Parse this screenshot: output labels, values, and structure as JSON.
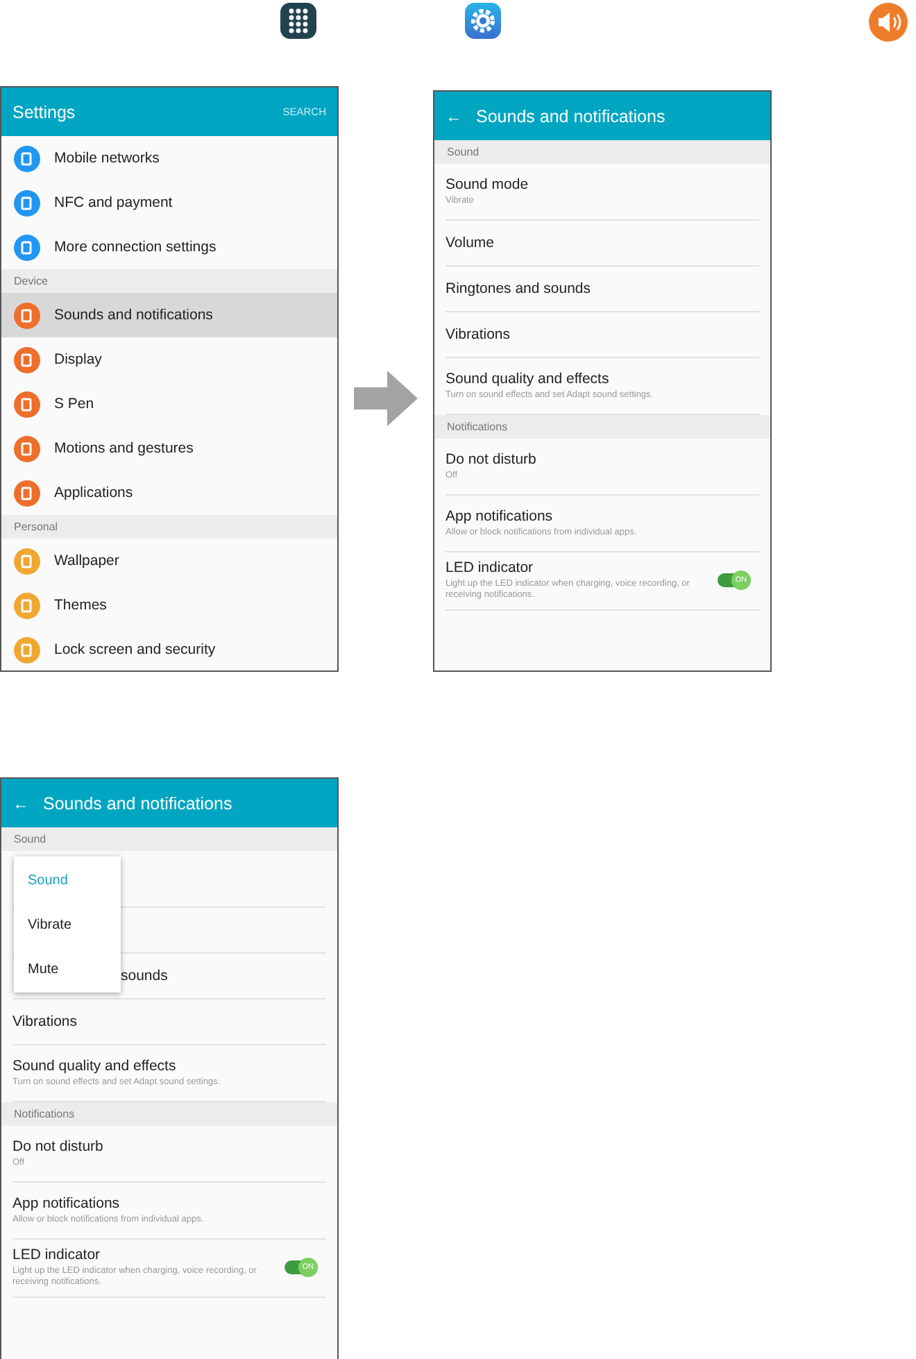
{
  "screens": [
    {
      "kind": "main",
      "title": "Settings",
      "action": "SEARCH",
      "rows": [
        {
          "kind": "item",
          "label": "Mobile networks",
          "color": "#2196f3",
          "selected": false
        },
        {
          "kind": "item",
          "label": "NFC and payment",
          "color": "#2196f3",
          "selected": false
        },
        {
          "kind": "item",
          "label": "More connection settings",
          "color": "#2196f3",
          "selected": false
        },
        {
          "kind": "section",
          "label": "Device"
        },
        {
          "kind": "item",
          "label": "Sounds and notifications",
          "color": "#ee6e2b",
          "selected": true
        },
        {
          "kind": "item",
          "label": "Display",
          "color": "#ee6e2b",
          "selected": false
        },
        {
          "kind": "item",
          "label": "S Pen",
          "color": "#ee6e2b",
          "selected": false
        },
        {
          "kind": "item",
          "label": "Motions and gestures",
          "color": "#ee6e2b",
          "selected": false
        },
        {
          "kind": "item",
          "label": "Applications",
          "color": "#ee6e2b",
          "selected": false
        },
        {
          "kind": "section",
          "label": "Personal"
        },
        {
          "kind": "item",
          "label": "Wallpaper",
          "color": "#f0a732",
          "selected": false
        },
        {
          "kind": "item",
          "label": "Themes",
          "color": "#f0a732",
          "selected": false
        },
        {
          "kind": "item",
          "label": "Lock screen and security",
          "color": "#f0a732",
          "selected": false
        }
      ]
    },
    {
      "kind": "sub",
      "title": "Sounds and notifications",
      "back": "←",
      "rows": [
        {
          "kind": "section",
          "label": "Sound"
        },
        {
          "kind": "item",
          "label": "Sound mode",
          "subtitle": "Vibrate"
        },
        {
          "kind": "item",
          "label": "Volume"
        },
        {
          "kind": "item",
          "label": "Ringtones and sounds"
        },
        {
          "kind": "item",
          "label": "Vibrations"
        },
        {
          "kind": "item",
          "label": "Sound quality and effects",
          "subtitle": "Turn on sound effects and set Adapt sound settings."
        },
        {
          "kind": "section",
          "label": "Notifications"
        },
        {
          "kind": "item",
          "label": "Do not disturb",
          "subtitle": "Off"
        },
        {
          "kind": "item",
          "label": "App notifications",
          "subtitle": "Allow or block notifications from individual apps."
        },
        {
          "kind": "toggle",
          "label": "LED indicator",
          "subtitle": "Light up the LED indicator when charging, voice recording, or receiving notifications.",
          "on": true,
          "toggle_label": "ON"
        }
      ]
    },
    {
      "kind": "sub",
      "title": "Sounds and notifications",
      "back": "←",
      "menu": [
        {
          "label": "Sound",
          "selected": true
        },
        {
          "label": "Vibrate",
          "selected": false
        },
        {
          "label": "Mute",
          "selected": false
        }
      ],
      "rows": [
        {
          "kind": "section",
          "label": "Sound"
        },
        {
          "kind": "blank_tall"
        },
        {
          "kind": "blank"
        },
        {
          "kind": "partial",
          "label": "sounds"
        },
        {
          "kind": "item",
          "label": "Vibrations"
        },
        {
          "kind": "item",
          "label": "Sound quality and effects",
          "subtitle": "Turn on sound effects and set Adapt sound settings."
        },
        {
          "kind": "section",
          "label": "Notifications"
        },
        {
          "kind": "item",
          "label": "Do not disturb",
          "subtitle": "Off"
        },
        {
          "kind": "item",
          "label": "App notifications",
          "subtitle": "Allow or block notifications from individual apps."
        },
        {
          "kind": "toggle",
          "label": "LED indicator",
          "subtitle": "Light up the LED indicator when charging, voice recording, or receiving notifications.",
          "on": true,
          "toggle_label": "ON"
        }
      ]
    }
  ]
}
